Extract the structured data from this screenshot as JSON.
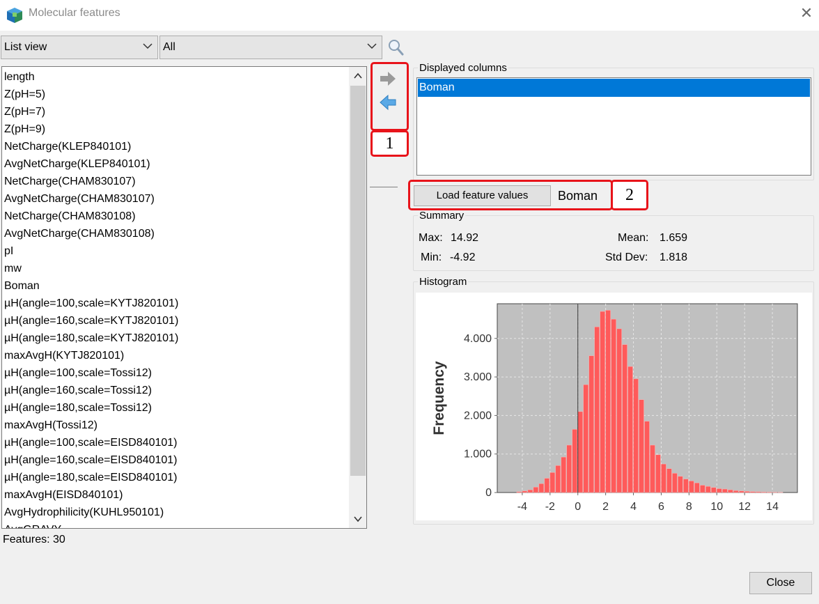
{
  "window": {
    "title": "Molecular features",
    "close_glyph": "✕"
  },
  "toolbar": {
    "view_select": {
      "selected": "List view"
    },
    "filter_select": {
      "selected": "All"
    }
  },
  "feature_list": {
    "items": [
      "length",
      "Z(pH=5)",
      "Z(pH=7)",
      "Z(pH=9)",
      "NetCharge(KLEP840101)",
      "AvgNetCharge(KLEP840101)",
      "NetCharge(CHAM830107)",
      "AvgNetCharge(CHAM830107)",
      "NetCharge(CHAM830108)",
      "AvgNetCharge(CHAM830108)",
      "pI",
      "mw",
      "Boman",
      "µH(angle=100,scale=KYTJ820101)",
      "µH(angle=160,scale=KYTJ820101)",
      "µH(angle=180,scale=KYTJ820101)",
      "maxAvgH(KYTJ820101)",
      "µH(angle=100,scale=Tossi12)",
      "µH(angle=160,scale=Tossi12)",
      "µH(angle=180,scale=Tossi12)",
      "maxAvgH(Tossi12)",
      "µH(angle=100,scale=EISD840101)",
      "µH(angle=160,scale=EISD840101)",
      "µH(angle=180,scale=EISD840101)",
      "maxAvgH(EISD840101)",
      "AvgHydrophilicity(KUHL950101)",
      "AvgGRAVY"
    ],
    "count_text": "Features: 30"
  },
  "annotations": {
    "callout_1": "1",
    "callout_2": "2"
  },
  "displayed_columns": {
    "legend": "Displayed columns",
    "items": [
      "Boman"
    ]
  },
  "load": {
    "button_label": "Load feature values",
    "loaded_feature": "Boman"
  },
  "summary": {
    "legend": "Summary",
    "max_label": "Max:",
    "max_value": "14.92",
    "min_label": "Min:",
    "min_value": "-4.92",
    "mean_label": "Mean:",
    "mean_value": "1.659",
    "std_label": "Std Dev:",
    "std_value": "1.818"
  },
  "histogram": {
    "legend": "Histogram"
  },
  "colors": {
    "bar_fill": "#ff5a5a",
    "plot_bg": "#c0c0c0",
    "selection": "#0078d7",
    "annotation": "#e8131a"
  },
  "footer": {
    "close_label": "Close"
  },
  "chart_data": {
    "type": "bar",
    "title": "",
    "xlabel": "",
    "ylabel": "Frequency",
    "xlim": [
      -5.8,
      15.8
    ],
    "ylim": [
      0,
      4900
    ],
    "x_ticks": [
      -4,
      -2,
      0,
      2,
      4,
      6,
      8,
      10,
      12,
      14
    ],
    "y_ticks": [
      0,
      1000,
      2000,
      3000,
      4000
    ],
    "y_tick_labels": [
      "0",
      "1.000",
      "2.000",
      "3.000",
      "4.000"
    ],
    "bin_width": 0.4,
    "x": [
      -4.2,
      -3.8,
      -3.4,
      -3.0,
      -2.6,
      -2.2,
      -1.8,
      -1.4,
      -1.0,
      -0.6,
      -0.2,
      0.2,
      0.6,
      1.0,
      1.4,
      1.8,
      2.2,
      2.6,
      3.0,
      3.4,
      3.8,
      4.2,
      4.6,
      5.0,
      5.4,
      5.8,
      6.2,
      6.6,
      7.0,
      7.4,
      7.8,
      8.2,
      8.6,
      9.0,
      9.4,
      9.8,
      10.2,
      10.6,
      11.0,
      11.4,
      11.8,
      12.2,
      12.6,
      13.0,
      13.4,
      13.8,
      14.2,
      14.6
    ],
    "values": [
      20,
      40,
      70,
      140,
      230,
      370,
      520,
      700,
      920,
      1230,
      1640,
      2100,
      2800,
      3550,
      4300,
      4700,
      4730,
      4500,
      4250,
      3840,
      3270,
      2950,
      2410,
      1850,
      1230,
      980,
      740,
      620,
      500,
      420,
      350,
      300,
      250,
      190,
      160,
      130,
      100,
      90,
      70,
      50,
      40,
      30,
      25,
      20,
      15,
      12,
      10,
      8
    ],
    "grid": true,
    "reference_line_x": 0
  }
}
